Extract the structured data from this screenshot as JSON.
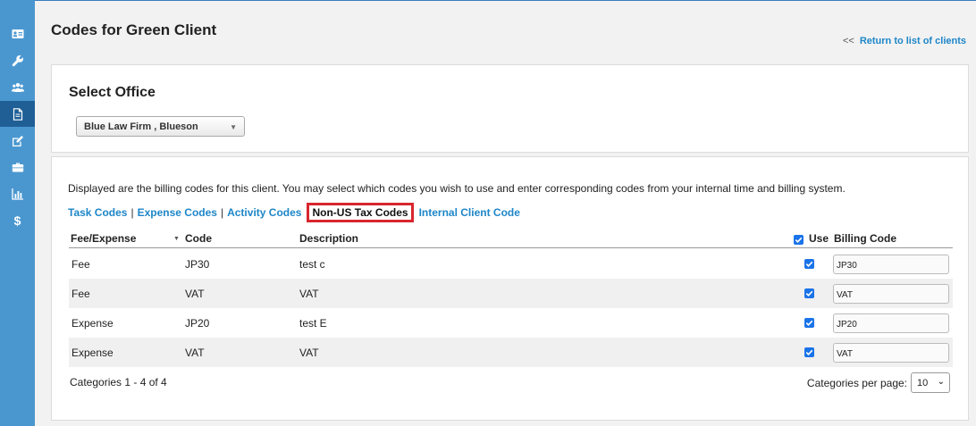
{
  "page": {
    "title": "Codes for Green Client",
    "return_arrows": "<<",
    "return_link": "Return to list of clients"
  },
  "sidebar": {
    "items": [
      {
        "icon": "contact-card-icon",
        "active": false
      },
      {
        "icon": "wrench-icon",
        "active": false
      },
      {
        "icon": "users-icon",
        "active": false
      },
      {
        "icon": "document-icon",
        "active": true
      },
      {
        "icon": "edit-icon",
        "active": false
      },
      {
        "icon": "briefcase-icon",
        "active": false
      },
      {
        "icon": "bar-chart-icon",
        "active": false
      },
      {
        "icon": "dollar-icon",
        "active": false,
        "glyph": "$"
      }
    ]
  },
  "office": {
    "heading": "Select Office",
    "selected": "Blue Law Firm , Blueson"
  },
  "codes": {
    "info": "Displayed are the billing codes for this client. You may select which codes you wish to use and enter corresponding codes from your internal time and billing system.",
    "tabs": [
      {
        "label": "Task Codes"
      },
      {
        "label": "Expense Codes"
      },
      {
        "label": "Activity Codes"
      },
      {
        "label": "Non-US Tax Codes",
        "current": true
      },
      {
        "label": "Internal Client Code"
      }
    ],
    "separator": "|",
    "columns": {
      "fee_expense": "Fee/Expense",
      "code": "Code",
      "description": "Description",
      "use": "Use",
      "billing_code": "Billing Code"
    },
    "rows": [
      {
        "fee_expense": "Fee",
        "code": "JP30",
        "description": "test c",
        "use": true,
        "billing_code": "JP30"
      },
      {
        "fee_expense": "Fee",
        "code": "VAT",
        "description": "VAT",
        "use": true,
        "billing_code": "VAT"
      },
      {
        "fee_expense": "Expense",
        "code": "JP20",
        "description": "test E",
        "use": true,
        "billing_code": "JP20"
      },
      {
        "fee_expense": "Expense",
        "code": "VAT",
        "description": "VAT",
        "use": true,
        "billing_code": "VAT"
      }
    ],
    "footer": {
      "range": "Categories 1 - 4 of 4",
      "per_page_label": "Categories per page:",
      "per_page_value": "10"
    }
  },
  "colors": {
    "sidebar": "#4a97d0",
    "sidebar_active": "#1f5f96",
    "link": "#1d86c8",
    "highlight": "#d8262e",
    "checkbox": "#1a73e8"
  }
}
